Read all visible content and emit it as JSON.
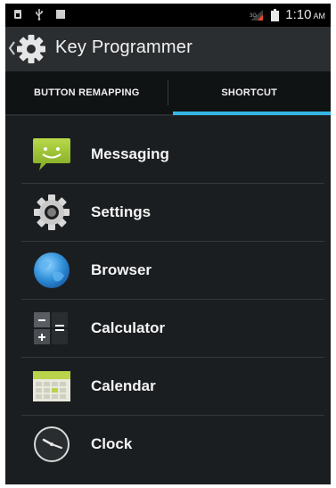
{
  "status_bar": {
    "time": "1:10",
    "ampm": "AM",
    "icons": [
      "sim-icon",
      "usb-icon",
      "notification-icon",
      "signal-icon",
      "battery-icon"
    ]
  },
  "action_bar": {
    "title": "Key Programmer",
    "icon": "gear-icon"
  },
  "tabs": [
    {
      "label": "BUTTON REMAPPING",
      "selected": false
    },
    {
      "label": "SHORTCUT",
      "selected": true
    }
  ],
  "accent_color": "#33b5e5",
  "apps": [
    {
      "label": "Messaging",
      "icon": "messaging-icon"
    },
    {
      "label": "Settings",
      "icon": "settings-gear-icon"
    },
    {
      "label": "Browser",
      "icon": "browser-globe-icon"
    },
    {
      "label": "Calculator",
      "icon": "calculator-icon"
    },
    {
      "label": "Calendar",
      "icon": "calendar-icon"
    },
    {
      "label": "Clock",
      "icon": "clock-icon"
    }
  ]
}
